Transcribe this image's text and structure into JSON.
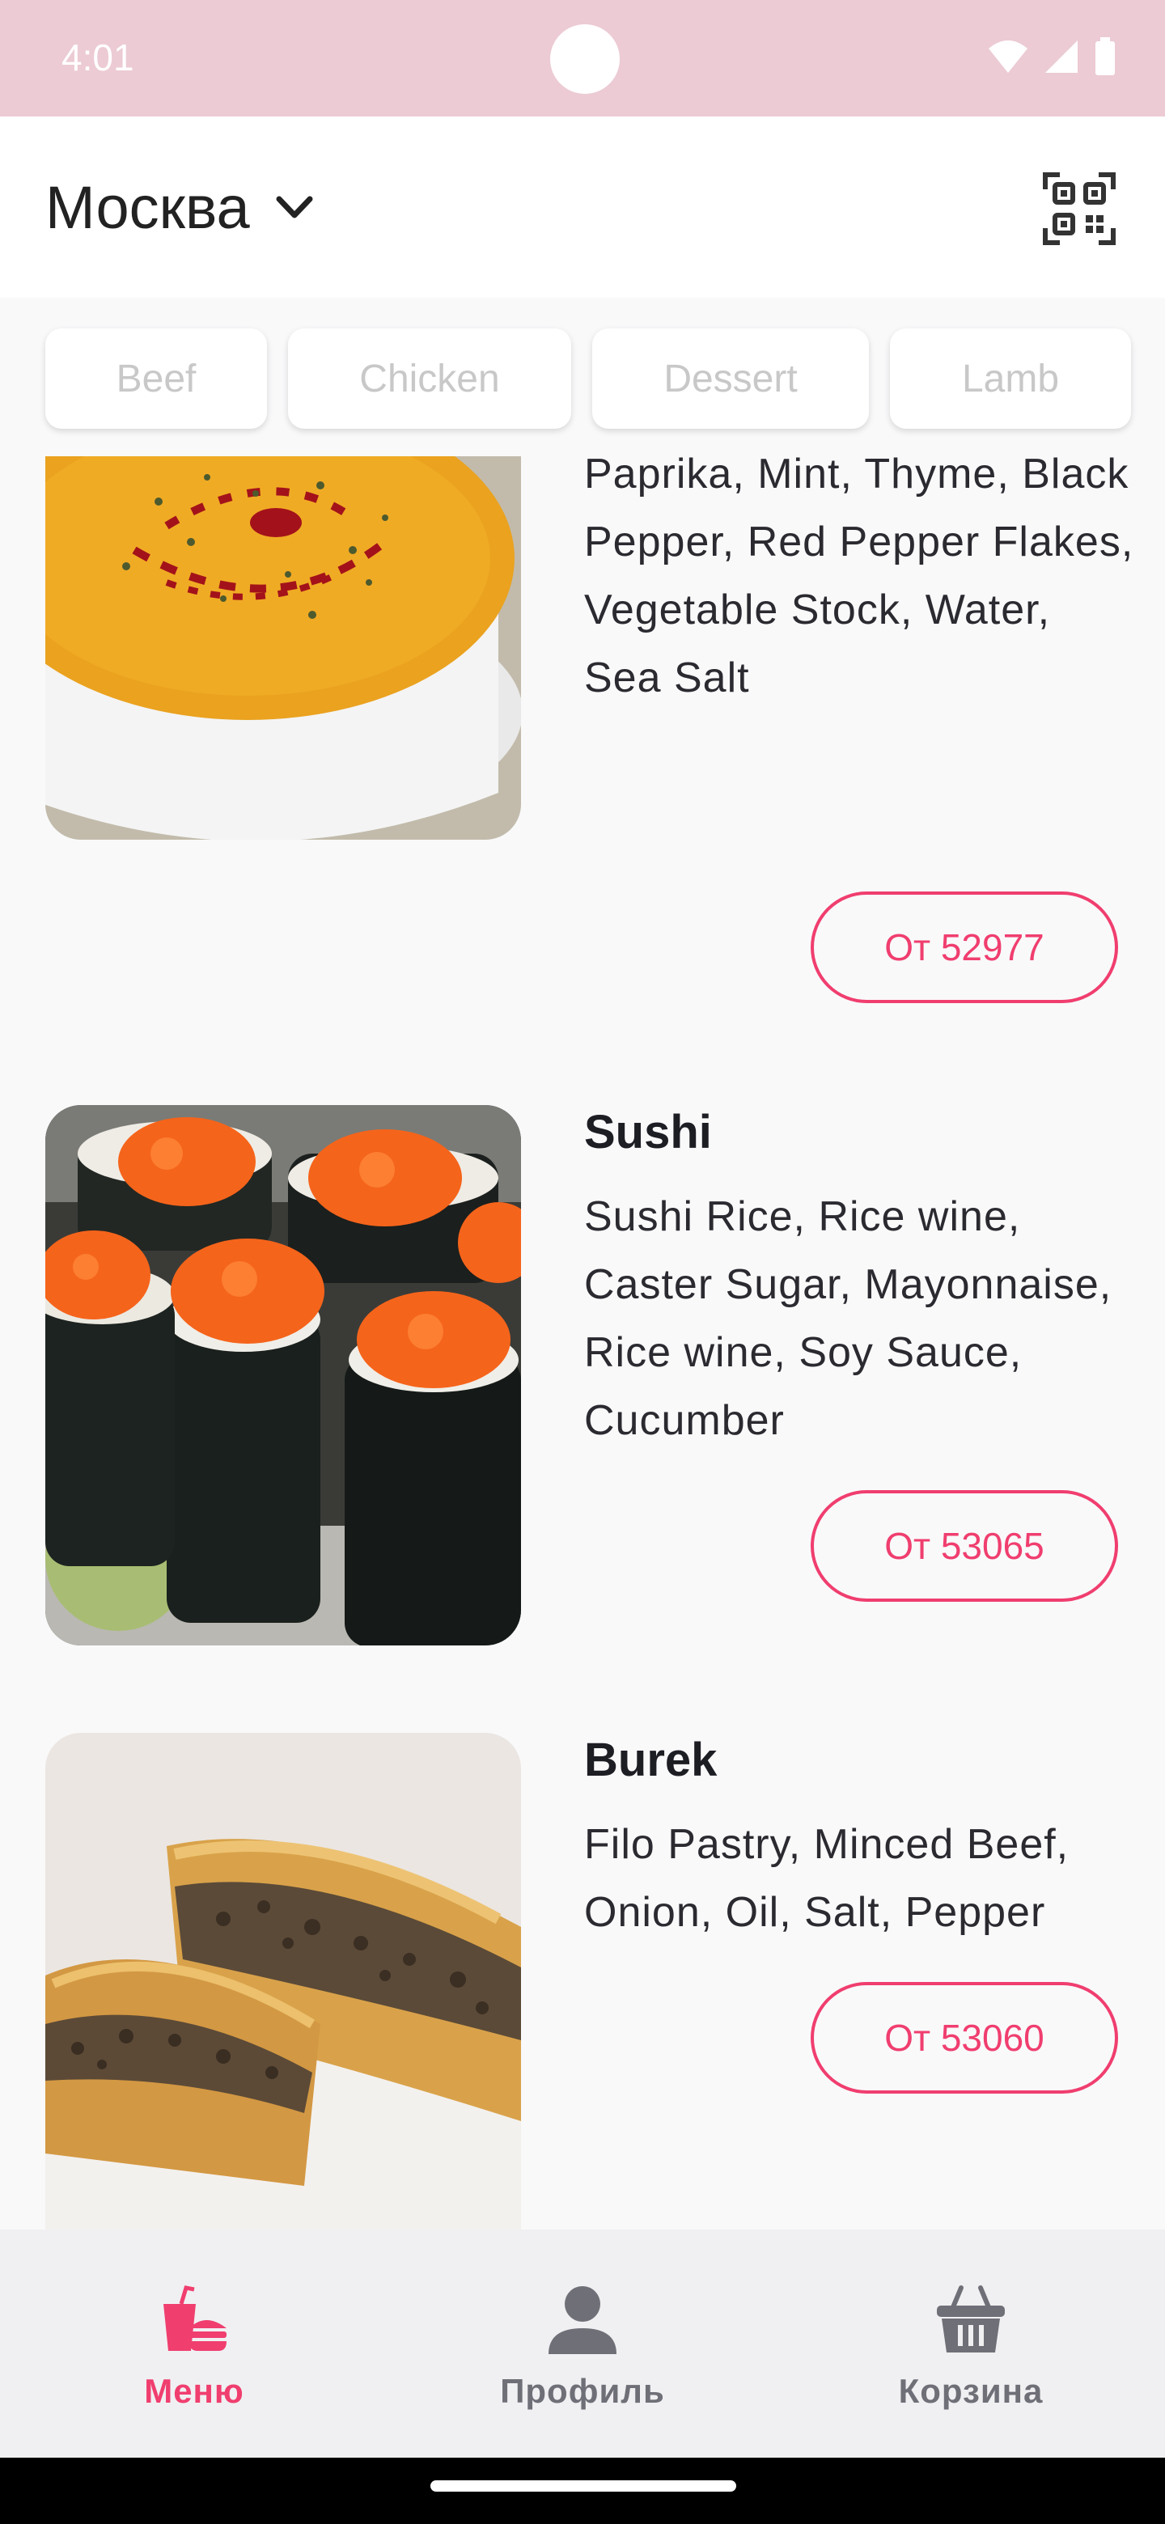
{
  "status_bar": {
    "time": "4:01"
  },
  "header": {
    "city": "Москва"
  },
  "categories": [
    "Beef",
    "Chicken",
    "Dessert",
    "Lamb"
  ],
  "items": [
    {
      "name": "",
      "ingredients": "Tomato Puree, Cumin, Paprika, Mint, Thyme, Black Pepper, Red Pepper Flakes, Vegetable Stock, Water, Sea Salt",
      "price_label": "От 52977"
    },
    {
      "name": "Sushi",
      "ingredients": "Sushi Rice, Rice wine, Caster Sugar, Mayonnaise, Rice wine, Soy Sauce, Cucumber",
      "price_label": "От 53065"
    },
    {
      "name": "Burek",
      "ingredients": "Filo Pastry, Minced Beef, Onion, Oil, Salt, Pepper",
      "price_label": "От 53060"
    }
  ],
  "bottom_nav": [
    {
      "label": "Меню",
      "icon": "fastfood-icon",
      "active": true
    },
    {
      "label": "Профиль",
      "icon": "person-icon",
      "active": false
    },
    {
      "label": "Корзина",
      "icon": "basket-icon",
      "active": false
    }
  ],
  "colors": {
    "accent": "#f03e6f",
    "status_bar": "#eccbd4",
    "inactive_icon": "#6f6f78"
  }
}
